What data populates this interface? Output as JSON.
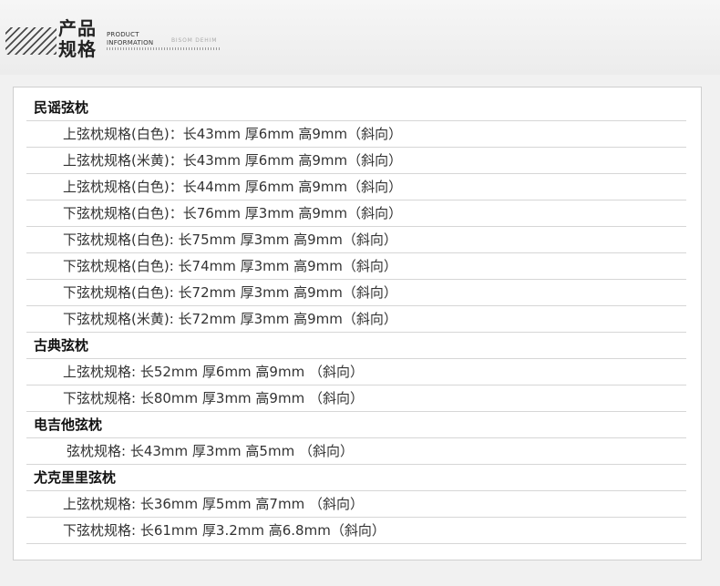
{
  "header": {
    "title_line1": "产品",
    "title_line2": "规格",
    "subtitle_line1": "PRODUCT",
    "subtitle_line2": "INFORMATION",
    "brand": "BISOM DEHIM"
  },
  "sections": [
    {
      "title": "民谣弦枕",
      "items": [
        "上弦枕规格(白色)：长43mm  厚6mm  高9mm（斜向）",
        "上弦枕规格(米黄)：长43mm  厚6mm  高9mm（斜向）",
        "上弦枕规格(白色)：长44mm  厚6mm  高9mm（斜向）",
        "下弦枕规格(白色)：长76mm  厚3mm  高9mm（斜向）",
        "下弦枕规格(白色): 长75mm  厚3mm  高9mm（斜向）",
        "下弦枕规格(白色): 长74mm  厚3mm  高9mm（斜向）",
        "下弦枕规格(白色): 长72mm  厚3mm  高9mm（斜向）",
        "下弦枕规格(米黄): 长72mm  厚3mm  高9mm（斜向）"
      ]
    },
    {
      "title": "古典弦枕",
      "items": [
        "上弦枕规格:  长52mm  厚6mm  高9mm （斜向）",
        "下弦枕规格:  长80mm  厚3mm  高9mm （斜向）"
      ]
    },
    {
      "title": "电吉他弦枕",
      "items": [
        "弦枕规格:  长43mm  厚3mm  高5mm （斜向）"
      ]
    },
    {
      "title": "尤克里里弦枕",
      "items": [
        "上弦枕规格:  长36mm  厚5mm  高7mm （斜向）",
        "下弦枕规格:  长61mm  厚3.2mm  高6.8mm（斜向）"
      ]
    }
  ]
}
